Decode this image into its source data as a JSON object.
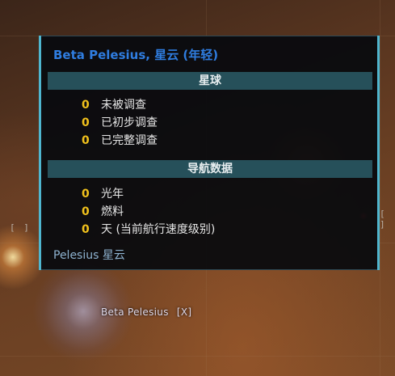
{
  "tooltip": {
    "title": "Beta Pelesius, 星云 (年轻)",
    "section_planets": "星球",
    "planets": [
      {
        "value": "0",
        "label": "未被调查"
      },
      {
        "value": "0",
        "label": "已初步调查"
      },
      {
        "value": "0",
        "label": "已完整调查"
      }
    ],
    "section_nav": "导航数据",
    "nav": [
      {
        "value": "0",
        "label": "光年"
      },
      {
        "value": "0",
        "label": "燃料"
      },
      {
        "value": "0",
        "label": "天 (当前航行速度级别)"
      }
    ],
    "footer": "Pelesius 星云"
  },
  "map": {
    "star_label": "Beta Pelesius",
    "star_marker": "[X]",
    "bracket_empty": "[ ]"
  },
  "colors": {
    "title": "#2f7de0",
    "section_bar": "#26505a",
    "value": "#f2c21c",
    "border_accent": "#4fb6cf",
    "footer": "#8eb2cf"
  }
}
